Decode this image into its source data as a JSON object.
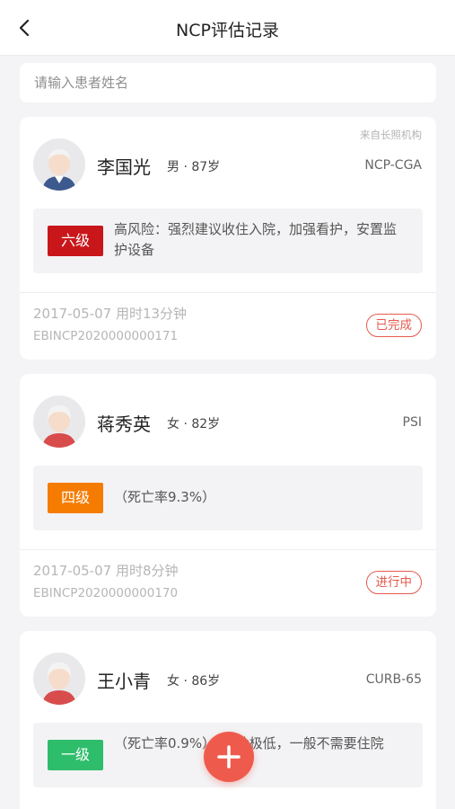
{
  "header": {
    "back_icon": "chevron-left-icon",
    "title": "NCP评估记录"
  },
  "search": {
    "placeholder": "请输入患者姓名",
    "value": ""
  },
  "records": [
    {
      "source": "来自长照机构",
      "name": "李国光",
      "meta": "男 · 87岁",
      "assessment_type": "NCP-CGA",
      "level": "六级",
      "level_color": "#c9161b",
      "risk_text": "高风险：强烈建议收住入院，加强看护，安置监护设备",
      "date_line": "2017-05-07  用时13分钟",
      "code": "EBINCP2020000000171",
      "status": "已完成",
      "avatar_shirt_color": "#3d5a8f"
    },
    {
      "source": "",
      "name": "蒋秀英",
      "meta": "女 · 82岁",
      "assessment_type": "PSI",
      "level": "四级",
      "level_color": "#f57c00",
      "risk_text": "（死亡率9.3%）",
      "date_line": "2017-05-07  用时8分钟",
      "code": "EBINCP2020000000170",
      "status": "进行中",
      "avatar_shirt_color": "#d94c4c"
    },
    {
      "source": "",
      "name": "王小青",
      "meta": "女 · 86岁",
      "assessment_type": "CURB-65",
      "level": "一级",
      "level_color": "#2ebd6b",
      "risk_text": "（死亡率0.9%）：危险极低，一般不需要住院",
      "avatar_shirt_color": "#d94c4c"
    }
  ],
  "fab": {
    "icon": "plus-icon",
    "color": "#ee5b4d"
  }
}
